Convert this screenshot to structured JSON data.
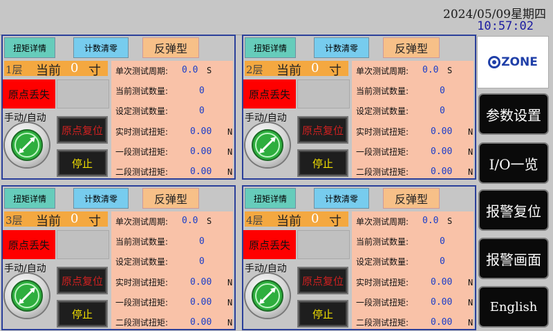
{
  "header": {
    "date": "2024/05/09星期四",
    "time": "10:57:02"
  },
  "panel_labels": {
    "torque_detail": "扭矩详情",
    "count_reset": "计数清零",
    "type": "反弹型",
    "current": "当前",
    "unit": "寸",
    "origin_lost": "原点丢失",
    "manual_auto": "手动/自动",
    "home_reset": "原点复位",
    "stop": "停止",
    "single_cycle": "单次测试周期:",
    "current_count": "当前测试数量:",
    "set_count": "设定测试数量:",
    "realtime_torque": "实时测试扭矩:",
    "stage1_torque": "一段测试扭矩:",
    "stage2_torque": "二段测试扭矩:",
    "unit_s": "S",
    "unit_n": "N"
  },
  "panels": [
    {
      "floor": "1层",
      "current_value": "0",
      "cycle": "0.0",
      "current_count": "0",
      "set_count": "0",
      "realtime_torque": "0.00",
      "stage1_torque": "0.00",
      "stage2_torque": "0.00"
    },
    {
      "floor": "2层",
      "current_value": "0",
      "cycle": "0.0",
      "current_count": "0",
      "set_count": "0",
      "realtime_torque": "0.00",
      "stage1_torque": "0.00",
      "stage2_torque": "0.00"
    },
    {
      "floor": "3层",
      "current_value": "0",
      "cycle": "0.0",
      "current_count": "0",
      "set_count": "0",
      "realtime_torque": "0.00",
      "stage1_torque": "0.00",
      "stage2_torque": "0.00"
    },
    {
      "floor": "4层",
      "current_value": "0",
      "cycle": "0.0",
      "current_count": "0",
      "set_count": "0",
      "realtime_torque": "0.00",
      "stage1_torque": "0.00",
      "stage2_torque": "0.00"
    }
  ],
  "sidebar": {
    "logo_text": "ZONE",
    "params": "参数设置",
    "io": "I/O一览",
    "alarm_reset": "报警复位",
    "alarm_screen": "报警画面",
    "english": "English"
  },
  "colors": {
    "alarm": "#ff0000",
    "info_bg": "#f9c2a8",
    "value_blue": "#1a3cc8",
    "panel_border": "#2a3f9a"
  }
}
